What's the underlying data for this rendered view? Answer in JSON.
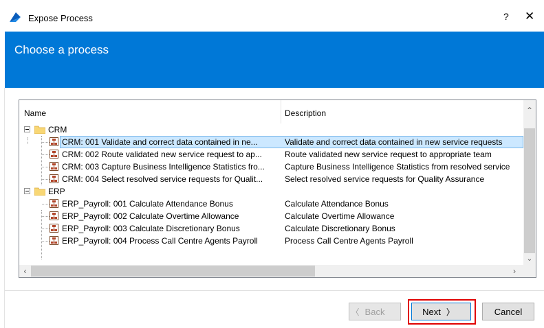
{
  "window": {
    "title": "Expose Process",
    "help_label": "?",
    "close_label": "✕"
  },
  "banner": {
    "title": "Choose a process"
  },
  "tree": {
    "columns": {
      "name": "Name",
      "description": "Description"
    },
    "groups": [
      {
        "name": "CRM",
        "items": [
          {
            "name": "CRM: 001 Validate and correct data contained in ne...",
            "description": "Validate and correct data contained in new service requests",
            "selected": true
          },
          {
            "name": "CRM: 002 Route validated new service request to ap...",
            "description": "Route validated new service request to appropriate team"
          },
          {
            "name": "CRM: 003 Capture Business Intelligence Statistics fro...",
            "description": "Capture Business Intelligence Statistics from resolved service"
          },
          {
            "name": "CRM: 004 Select resolved service requests for Qualit...",
            "description": "Select resolved service requests for Quality Assurance"
          }
        ]
      },
      {
        "name": "ERP",
        "items": [
          {
            "name": "ERP_Payroll: 001 Calculate Attendance Bonus",
            "description": "Calculate Attendance Bonus"
          },
          {
            "name": "ERP_Payroll: 002 Calculate Overtime Allowance",
            "description": "Calculate Overtime Allowance"
          },
          {
            "name": "ERP_Payroll: 003 Calculate Discretionary Bonus",
            "description": "Calculate Discretionary Bonus"
          },
          {
            "name": "ERP_Payroll: 004 Process Call Centre Agents Payroll",
            "description": "Process Call Centre Agents Payroll"
          }
        ]
      }
    ]
  },
  "buttons": {
    "back": "Back",
    "next": "Next",
    "cancel": "Cancel",
    "back_arrow": "〈",
    "next_arrow": "〉"
  },
  "colors": {
    "accent": "#0078d7",
    "selection": "#cce8ff",
    "highlight": "#e00000"
  }
}
